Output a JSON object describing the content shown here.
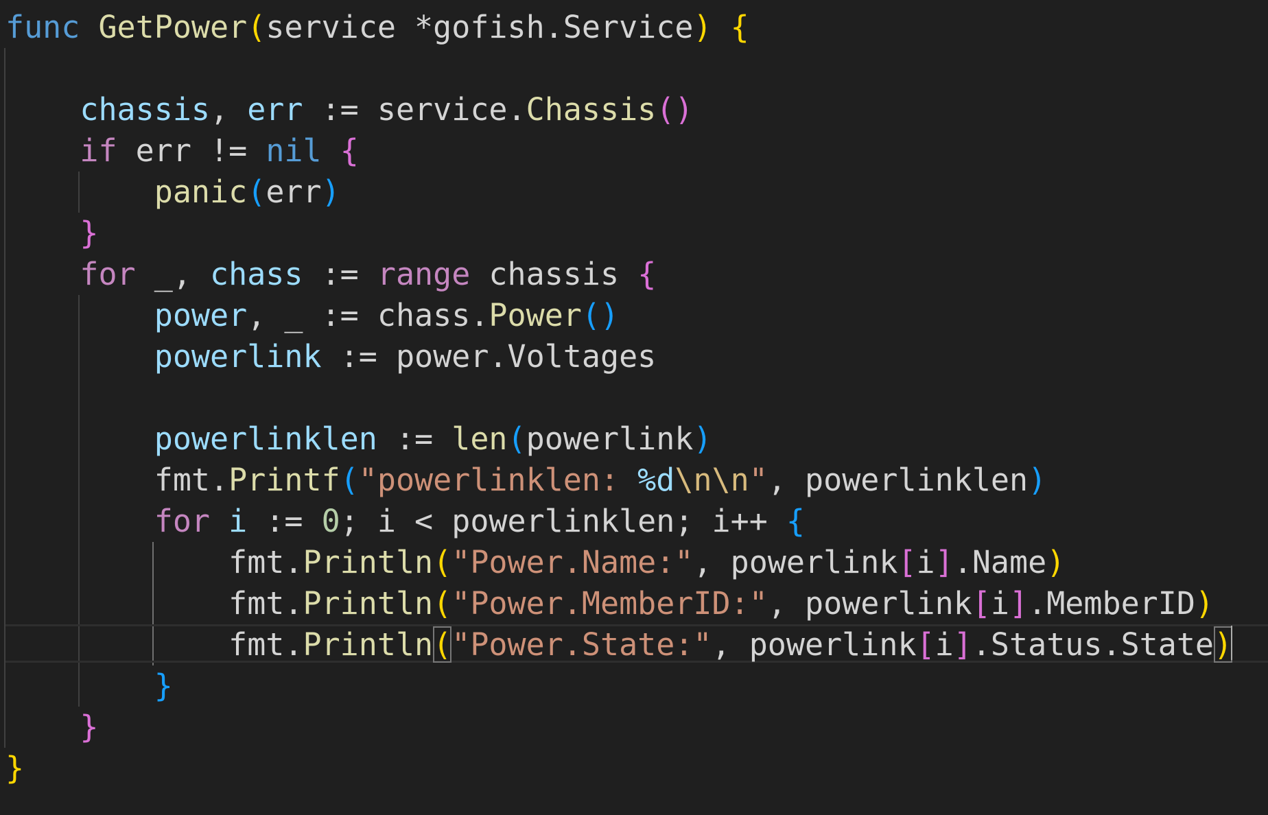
{
  "editor": {
    "language": "go",
    "theme_colors": {
      "background": "#1f1f1f",
      "keyword": "#569cd6",
      "control": "#c586c0",
      "function": "#dcdcaa",
      "variable": "#9cdcfe",
      "string": "#ce9178",
      "bracket_gold": "#ffd700",
      "bracket_orchid": "#da70d6",
      "bracket_blue": "#179fff"
    },
    "lines": [
      {
        "tokens": [
          "func",
          " ",
          "GetPower",
          "(",
          "service *gofish.Service",
          ")",
          " ",
          "{"
        ]
      },
      {
        "tokens": []
      },
      {
        "tokens": [
          "    ",
          "chassis",
          ", ",
          "err",
          " := service.",
          "Chassis",
          "(",
          ")"
        ]
      },
      {
        "tokens": [
          "    ",
          "if",
          " err != ",
          "nil",
          " ",
          "{"
        ]
      },
      {
        "tokens": [
          "        ",
          "panic",
          "(",
          "err",
          ")"
        ]
      },
      {
        "tokens": [
          "    ",
          "}"
        ]
      },
      {
        "tokens": [
          "    ",
          "for",
          " _, ",
          "chass",
          " := ",
          "range",
          " chassis ",
          "{"
        ]
      },
      {
        "tokens": [
          "        ",
          "power",
          ", _ := chass.",
          "Power",
          "(",
          ")"
        ]
      },
      {
        "tokens": [
          "        ",
          "powerlink",
          " := power.Voltages"
        ]
      },
      {
        "tokens": []
      },
      {
        "tokens": [
          "        ",
          "powerlinklen",
          " := ",
          "len",
          "(",
          "powerlink",
          ")"
        ]
      },
      {
        "tokens": [
          "        ",
          "fmt.",
          "Printf",
          "(",
          "\"powerlinklen: ",
          "%d",
          "\\n\\n",
          "\"",
          ", powerlinklen",
          ")"
        ]
      },
      {
        "tokens": [
          "        ",
          "for",
          " ",
          "i",
          " := ",
          "0",
          "; i < powerlinklen; i++ ",
          "{"
        ]
      },
      {
        "tokens": [
          "            ",
          "fmt.",
          "Println",
          "(",
          "\"Power.Name:\"",
          ", powerlink",
          "[",
          "i",
          "]",
          ".Name",
          ")"
        ]
      },
      {
        "tokens": [
          "            ",
          "fmt.",
          "Println",
          "(",
          "\"Power.MemberID:\"",
          ", powerlink",
          "[",
          "i",
          "]",
          ".MemberID",
          ")"
        ]
      },
      {
        "tokens": [
          "            ",
          "fmt.",
          "Println",
          "(",
          "\"Power.State:\"",
          ", powerlink",
          "[",
          "i",
          "]",
          ".Status.State",
          ")"
        ]
      },
      {
        "tokens": [
          "        ",
          "}"
        ]
      },
      {
        "tokens": [
          "    ",
          "}"
        ]
      },
      {
        "tokens": [
          "}"
        ]
      }
    ]
  }
}
